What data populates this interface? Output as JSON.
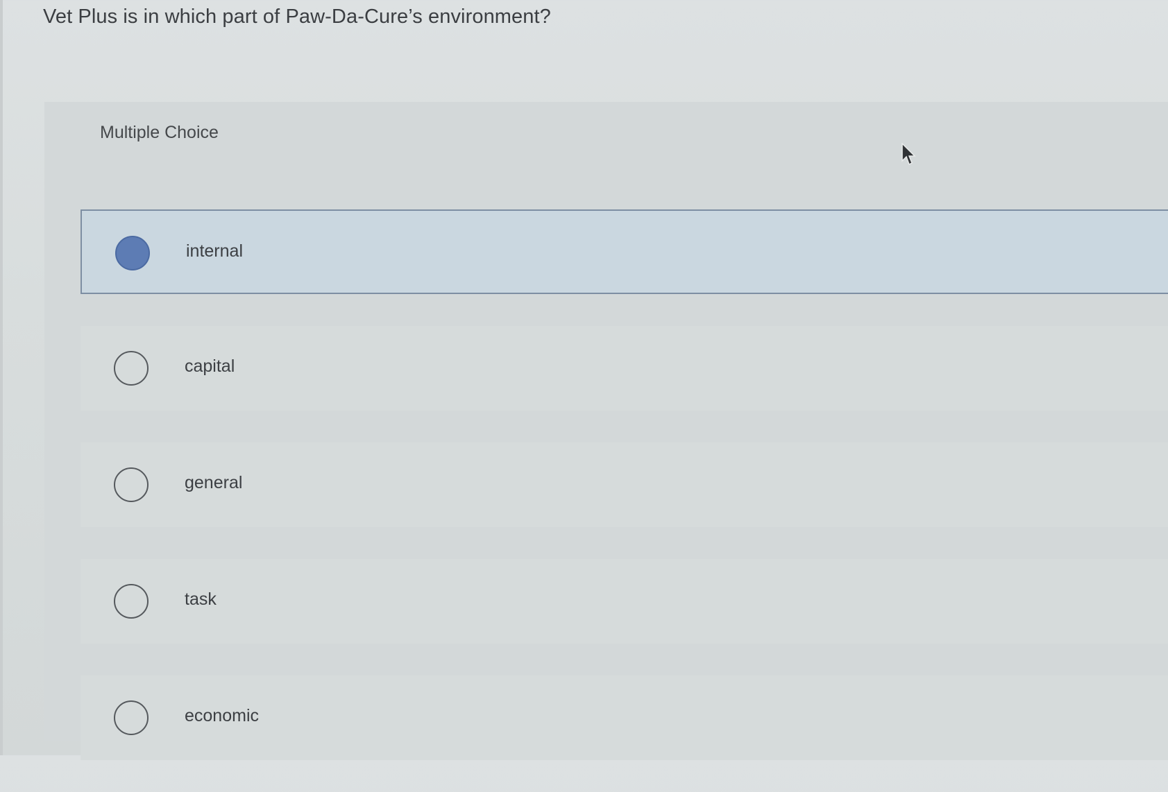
{
  "question": {
    "text": "Vet Plus is in which part of Paw-Da-Cure’s environment?"
  },
  "panel": {
    "label": "Multiple Choice"
  },
  "options": [
    {
      "label": "internal",
      "selected": true
    },
    {
      "label": "capital",
      "selected": false
    },
    {
      "label": "general",
      "selected": false
    },
    {
      "label": "task",
      "selected": false
    },
    {
      "label": "economic",
      "selected": false
    }
  ],
  "colors": {
    "selected_fill": "#5d7cb4",
    "selected_row": "#cad7e0",
    "background": "#d8dddd"
  },
  "icons": {
    "cursor": "mouse-pointer-icon"
  }
}
